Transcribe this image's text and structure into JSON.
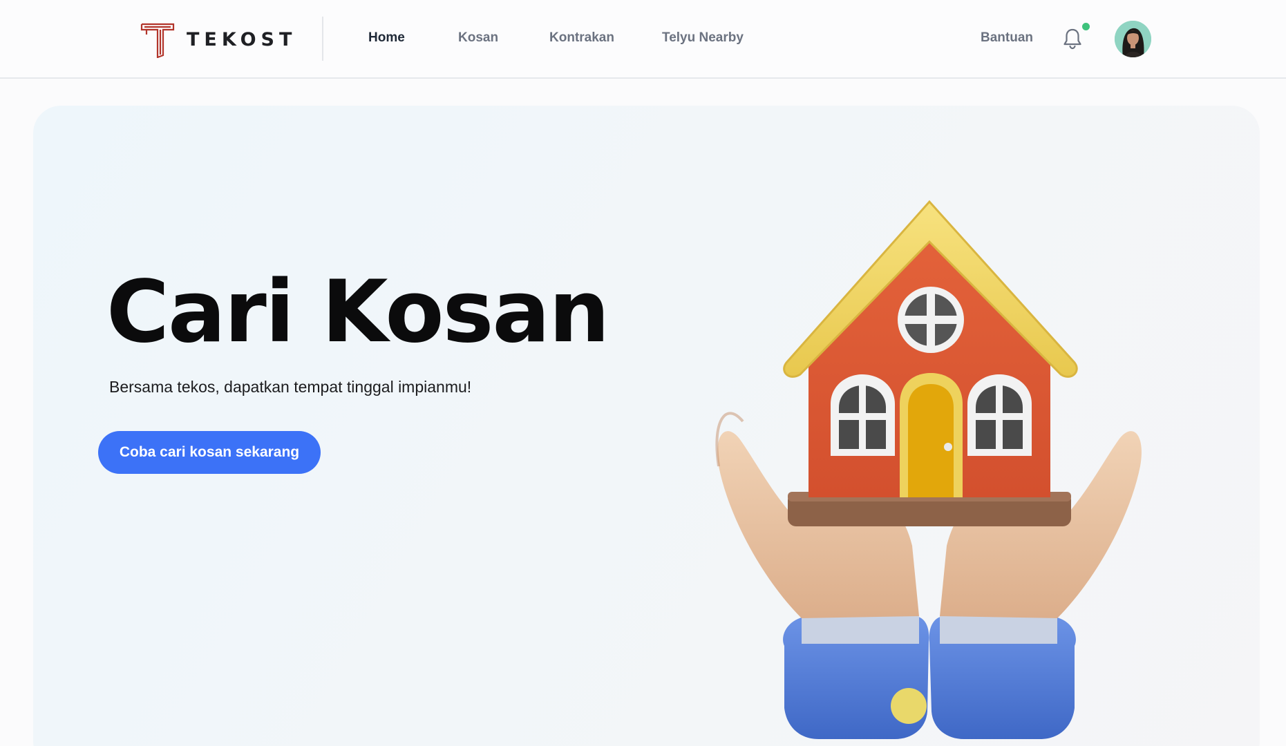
{
  "brand": {
    "name": "TEKOST",
    "logo_icon": "tekost-t-logo",
    "logo_color": "#c0392b"
  },
  "nav": {
    "items": [
      {
        "label": "Home",
        "active": true
      },
      {
        "label": "Kosan",
        "active": false
      },
      {
        "label": "Kontrakan",
        "active": false
      },
      {
        "label": "Telyu Nearby",
        "active": false
      }
    ],
    "help_label": "Bantuan",
    "notification_icon": "bell-icon",
    "notification_status_color": "#3ec27c",
    "avatar_icon": "user-avatar"
  },
  "hero": {
    "title": "Cari Kosan",
    "subtitle": "Bersama tekos, dapatkan tempat tinggal impianmu!",
    "cta_label": "Coba cari kosan sekarang",
    "cta_color": "#3c72f7",
    "illustration": "hands-holding-house-illustration"
  }
}
